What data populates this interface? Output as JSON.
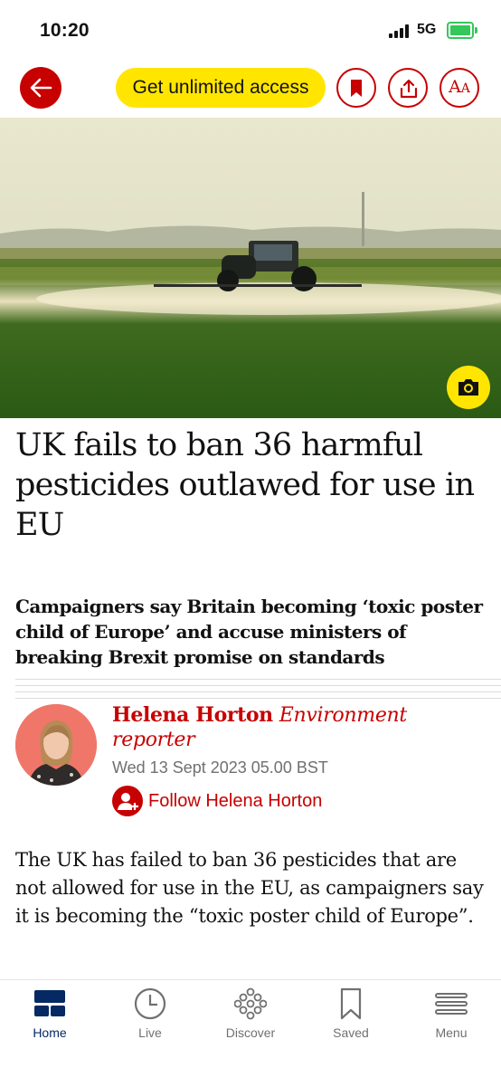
{
  "status_bar": {
    "time": "10:20",
    "network": "5G"
  },
  "toolbar": {
    "back_icon": "arrow-left-icon",
    "access_label": "Get unlimited access",
    "bookmark_icon": "bookmark-icon",
    "share_icon": "share-icon",
    "text_size_label_large": "A",
    "text_size_label_small": "A"
  },
  "hero": {
    "image": "tractor spraying pesticide over a green field",
    "camera_icon": "camera-icon"
  },
  "article": {
    "headline": "UK fails to ban 36 harmful pesticides outlawed for use in EU",
    "standfirst": "Campaigners say Britain becoming ‘toxic poster child of Europe’ and accuse ministers of breaking Brexit promise on standards",
    "author_name": "Helena Horton",
    "author_role": "Environment reporter",
    "date": "Wed 13 Sept 2023 05.00 BST",
    "follow_label": "Follow Helena Horton",
    "body_first_paragraph": "The UK has failed to ban 36 pesticides that are not allowed for use in the EU, as campaigners say it is becoming the “toxic poster child of Europe”."
  },
  "tabbar": {
    "items": [
      {
        "label": "Home",
        "icon": "home-icon",
        "active": true
      },
      {
        "label": "Live",
        "icon": "clock-icon",
        "active": false
      },
      {
        "label": "Discover",
        "icon": "discover-icon",
        "active": false
      },
      {
        "label": "Saved",
        "icon": "bookmark-icon",
        "active": false
      },
      {
        "label": "Menu",
        "icon": "menu-icon",
        "active": false
      }
    ]
  },
  "colors": {
    "brand_red": "#c70000",
    "access_yellow": "#ffe500",
    "nav_blue": "#052962",
    "muted_grey": "#707070"
  }
}
